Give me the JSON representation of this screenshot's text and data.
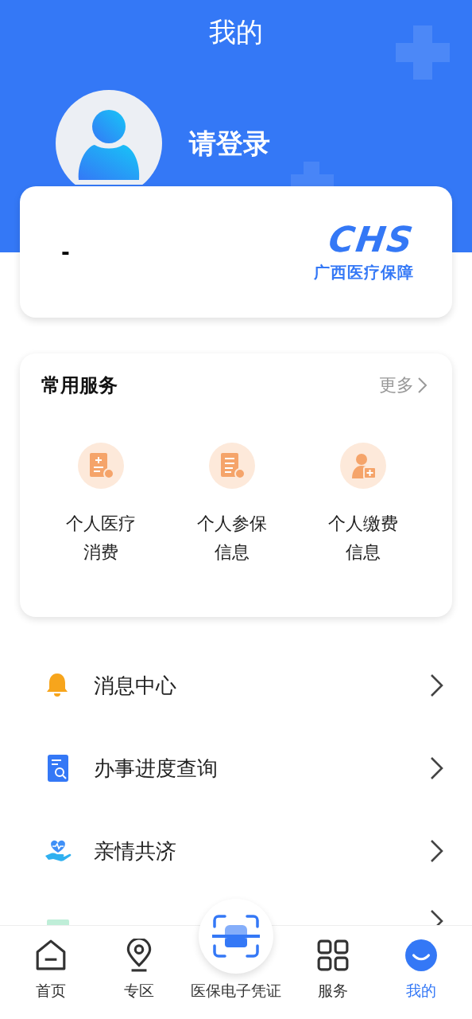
{
  "header": {
    "title": "我的",
    "login_prompt": "请登录"
  },
  "card": {
    "number": "-",
    "logo_text": "CHS",
    "org": "广西医疗保障"
  },
  "services": {
    "title": "常用服务",
    "more": "更多",
    "items": [
      {
        "label": "个人医疗消费",
        "kind": "bill"
      },
      {
        "label": "个人参保信息",
        "kind": "doc"
      },
      {
        "label": "个人缴费信息",
        "kind": "person"
      }
    ]
  },
  "menu": [
    {
      "label": "消息中心",
      "kind": "bell"
    },
    {
      "label": "办事进度查询",
      "kind": "search-doc"
    },
    {
      "label": "亲情共济",
      "kind": "care"
    },
    {
      "kind": "green"
    }
  ],
  "nav": [
    {
      "label": "首页",
      "kind": "home",
      "selected": false
    },
    {
      "label": "专区",
      "kind": "pin",
      "selected": false
    },
    {
      "label": "医保电子凭证",
      "kind": "scan",
      "selected": false
    },
    {
      "label": "服务",
      "kind": "grid",
      "selected": false
    },
    {
      "label": "我的",
      "kind": "me",
      "selected": true
    }
  ]
}
